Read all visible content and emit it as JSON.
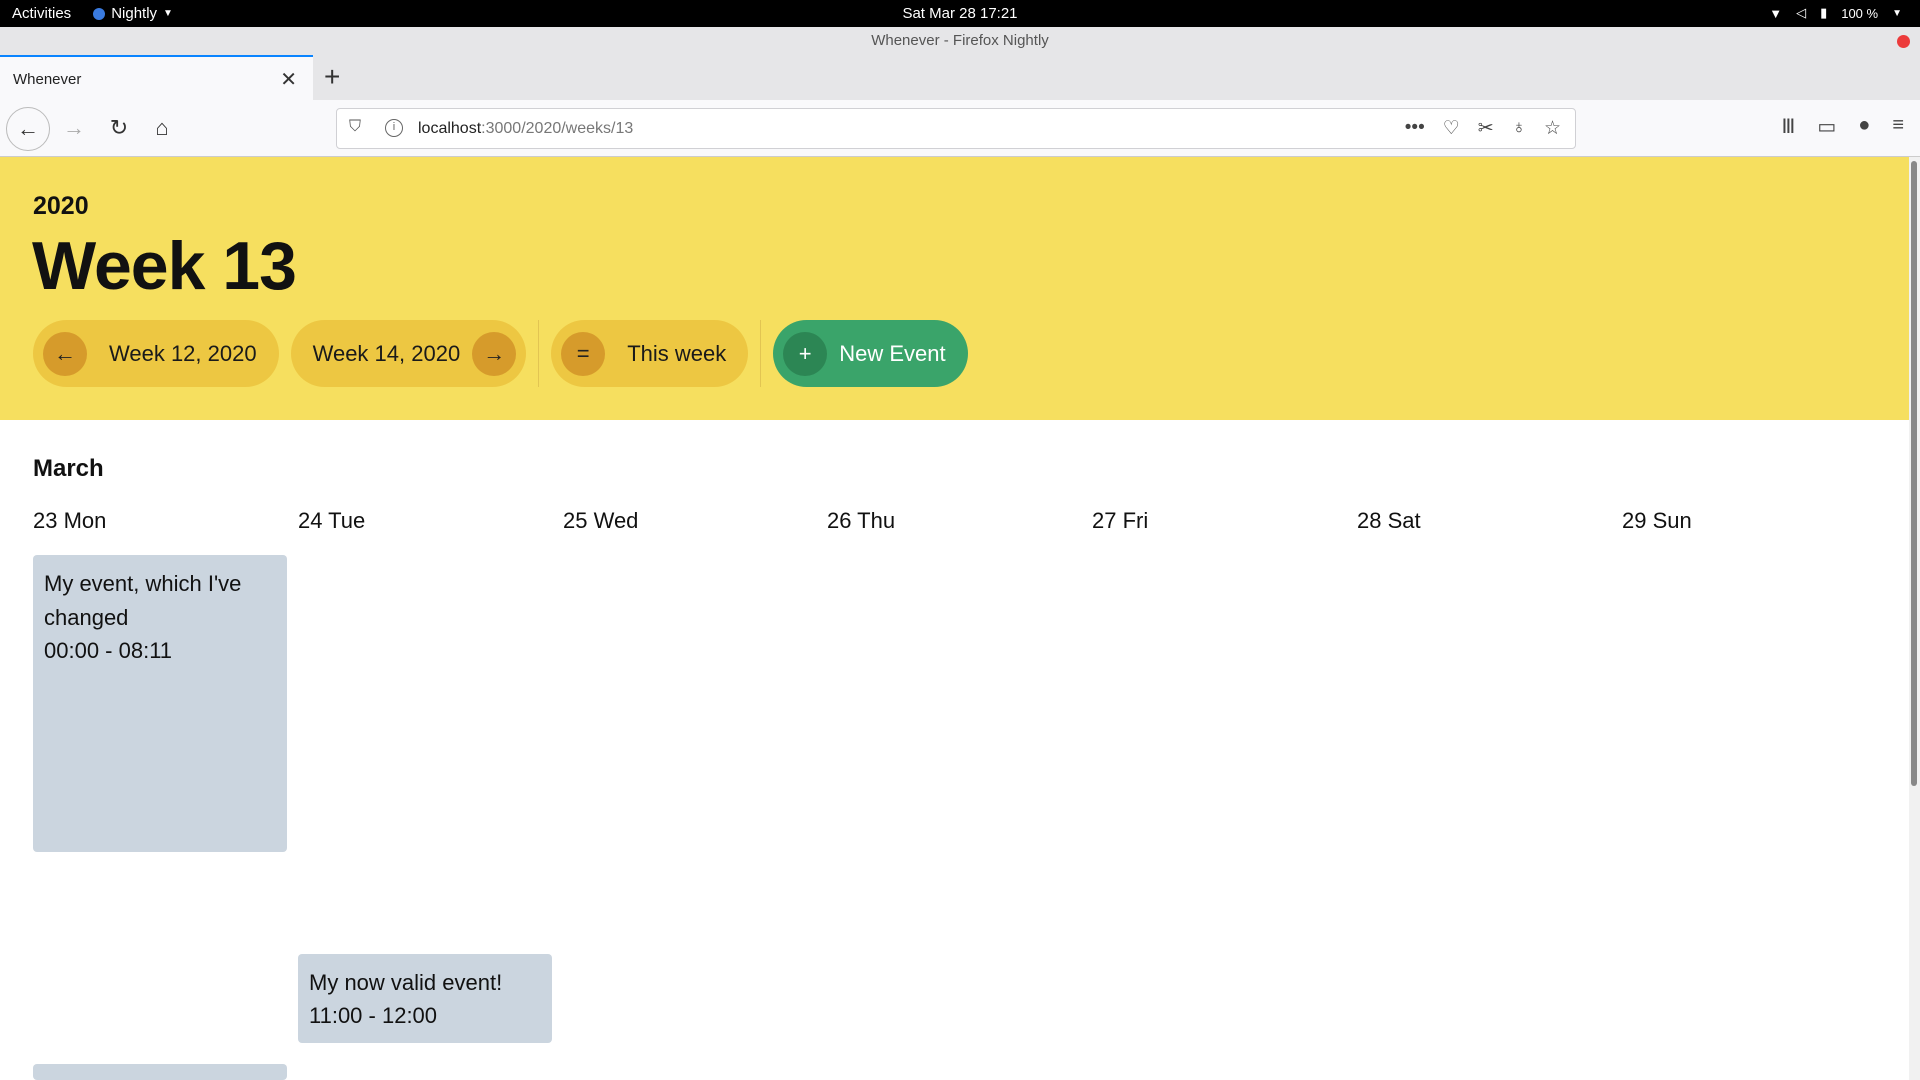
{
  "system_bar": {
    "activities": "Activities",
    "app_name": "Nightly",
    "clock": "Sat Mar 28  17:21",
    "battery": "100 %"
  },
  "window": {
    "title": "Whenever - Firefox Nightly"
  },
  "tab": {
    "title": "Whenever"
  },
  "url": {
    "host": "localhost",
    "path": ":3000/2020/weeks/13"
  },
  "header": {
    "year": "2020",
    "title": "Week 13",
    "prev_label": "Week 12, 2020",
    "prev_icon": "←",
    "next_label": "Week 14, 2020",
    "next_icon": "→",
    "today_label": "This week",
    "today_icon": "=",
    "new_label": "New Event",
    "new_icon": "+"
  },
  "calendar": {
    "month": "March",
    "days": [
      "23 Mon",
      "24 Tue",
      "25 Wed",
      "26 Thu",
      "27 Fri",
      "28 Sat",
      "29 Sun"
    ],
    "events": [
      {
        "title": "My event, which I've changed",
        "time": "00:00 - 08:11",
        "day": "23 Mon"
      },
      {
        "title": "My now valid event!",
        "time": "11:00 - 12:00",
        "day": "24 Tue"
      },
      {
        "title": "",
        "time": "",
        "day": "23 Mon"
      }
    ]
  },
  "colors": {
    "hero": "#f6df5f",
    "pill": "#edc742",
    "pill_icon": "#d69b2b",
    "new_event": "#3aa46a",
    "event_bg": "#cbd5df"
  }
}
